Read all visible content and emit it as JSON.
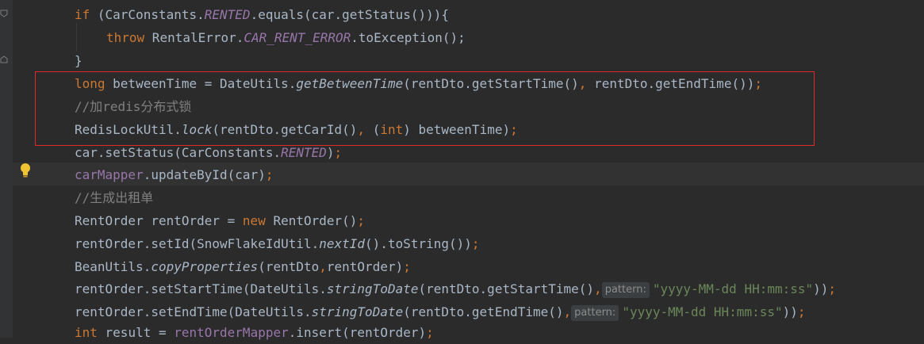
{
  "colors": {
    "keyword": "#cc7832",
    "static": "#9876aa",
    "comment": "#808080",
    "string": "#6a8759",
    "text": "#a9b7c6",
    "highlight_box": "#e0292a"
  },
  "icons": {
    "bulb": "lightbulb-icon",
    "fold": "fold-marker-icon"
  },
  "code": {
    "l1": {
      "a": "if",
      "b": " (CarConstants.",
      "c": "RENTED",
      "d": ".equals(car.getStatus())){"
    },
    "l2": {
      "a": "throw",
      "b": " RentalError.",
      "c": "CAR_RENT_ERROR",
      "d": ".toException();"
    },
    "l3": {
      "a": "}"
    },
    "l4": {
      "a": "long",
      "b": " betweenTime = DateUtils.",
      "c": "getBetweenTime",
      "d": "(rentDto.getStartTime()",
      ",": ",",
      "e": " rentDto.getEndTime())",
      ";": ";"
    },
    "l5": {
      "a": "//加redis分布式锁"
    },
    "l6": {
      "a": "RedisLockUtil.",
      "b": "lock",
      "c": "(rentDto.getCarId()",
      "d": ",",
      "e": " (",
      "f": "int",
      "g": ") betweenTime)",
      "h": ";"
    },
    "l7": {
      "a": "car.setStatus(CarConstants.",
      "b": "RENTED",
      ")": ")",
      ";": ";"
    },
    "l8": {
      "a": "carMapper",
      "b": ".updateById(car)",
      ";": ";"
    },
    "l9": {
      "a": "//生成出租单"
    },
    "l10": {
      "a": "RentOrder rentOrder = ",
      "b": "new",
      "c": " RentOrder()",
      ";": ";"
    },
    "l11": {
      "a": "rentOrder.setId(SnowFlakeIdUtil.",
      "b": "nextId",
      "c": "().toString())",
      ";": ";"
    },
    "l12": {
      "a": "BeanUtils.",
      "b": "copyProperties",
      "c": "(rentDto",
      "d": ",",
      "e": "rentOrder)",
      ";": ";"
    },
    "l13": {
      "a": "rentOrder.setStartTime(DateUtils.",
      "b": "stringToDate",
      "c": "(rentDto.getStartTime()",
      "d": ",",
      "hint": "pattern:",
      "s": "\"yyyy-MM-dd HH:mm:ss\"",
      "e": "))",
      ";": ";"
    },
    "l14": {
      "a": "rentOrder.setEndTime(DateUtils.",
      "b": "stringToDate",
      "c": "(rentDto.getEndTime()",
      "d": ",",
      "hint": "pattern:",
      "s": "\"yyyy-MM-dd HH:mm:ss\"",
      "e": "))",
      ";": ";"
    },
    "l15": {
      "a": "int",
      "b": " result = ",
      "c": "rentOrderMapper",
      "d": ".insert(rentOrder)",
      ";": ";"
    }
  }
}
